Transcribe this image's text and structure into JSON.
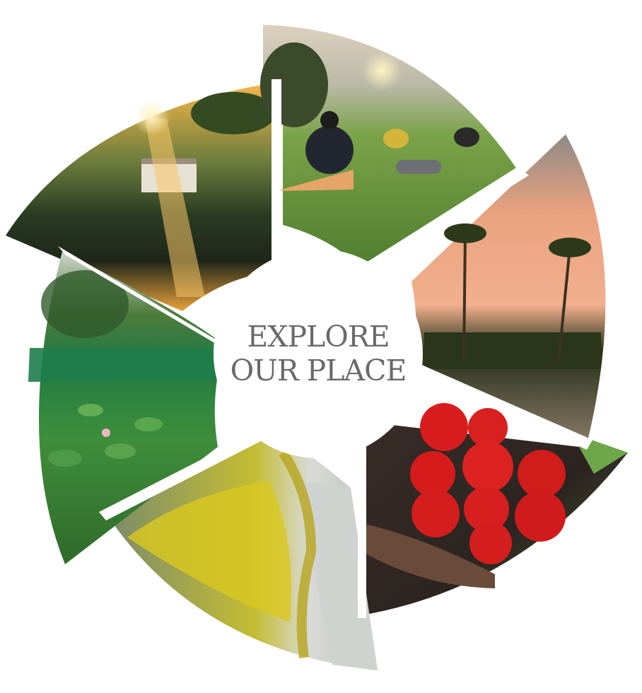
{
  "headline": {
    "line1": "EXPLORE",
    "line2": "OUR PLACE",
    "color": "#6a6a6a"
  },
  "photos": [
    {
      "subject": "sunrise over pond with house reflection",
      "tones": [
        "#f2a93b",
        "#3e5a2a",
        "#1d2a1b"
      ]
    },
    {
      "subject": "outdoor group meditation on lawn at sunrise",
      "tones": [
        "#e6d7c3",
        "#5f8f3a",
        "#2b2b2b"
      ]
    },
    {
      "subject": "palm trees at sunset over backwaters",
      "tones": [
        "#e9a27e",
        "#6b5a4e",
        "#223018"
      ]
    },
    {
      "subject": "hands holding bowl of tomatoes",
      "tones": [
        "#d81e1e",
        "#3a2d27",
        "#5b8a3a"
      ]
    },
    {
      "subject": "yellow flowering vine on building",
      "tones": [
        "#e7d21d",
        "#6a7a3b",
        "#cfd2cf"
      ]
    },
    {
      "subject": "lotus pond with green netting and trees",
      "tones": [
        "#3e8a3a",
        "#7fb25d",
        "#d4d8cf"
      ]
    }
  ]
}
